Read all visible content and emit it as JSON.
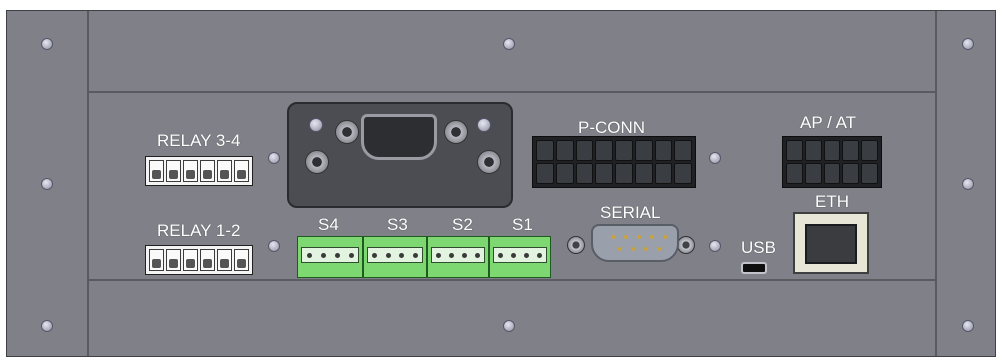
{
  "panel": {
    "labels": {
      "relay_3_4": "RELAY 3-4",
      "relay_1_2": "RELAY 1-2",
      "s4": "S4",
      "s3": "S3",
      "s2": "S2",
      "s1": "S1",
      "p_conn": "P-CONN",
      "ap_at": "AP / AT",
      "serial": "SERIAL",
      "usb": "USB",
      "eth": "ETH"
    },
    "colors": {
      "panel": "#7f8088",
      "relay_block": "#f4f4f4",
      "sensor_block": "#7dd872",
      "header_block": "#1f2124",
      "eth_jack": "#e8e6d6"
    }
  }
}
